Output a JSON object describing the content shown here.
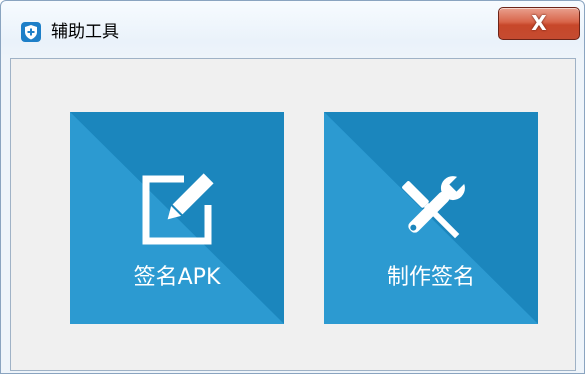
{
  "window": {
    "title": "辅助工具",
    "close_label": "X"
  },
  "tiles": [
    {
      "label": "签名APK",
      "icon": "edit-icon"
    },
    {
      "label": "制作签名",
      "icon": "tools-icon"
    }
  ],
  "colors": {
    "tile_light": "#2a98cf",
    "tile_dark": "#1b86bd",
    "client_bg": "#f0f0f0",
    "close_red": "#c7472a"
  }
}
